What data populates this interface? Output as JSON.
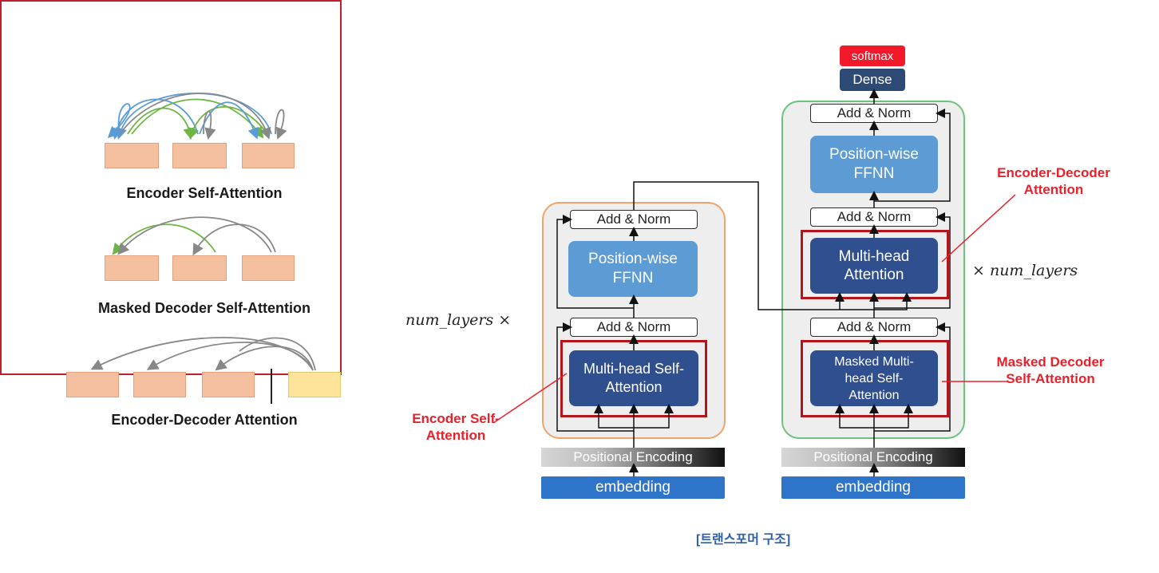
{
  "left_panel": {
    "encoder_self_attention": "Encoder Self-Attention",
    "masked_decoder_self_attention": "Masked Decoder Self-Attention",
    "encoder_decoder_attention": "Encoder-Decoder Attention"
  },
  "encoder": {
    "add_norm_top": "Add & Norm",
    "ffnn": "Position-wise FFNN",
    "add_norm_bottom": "Add & Norm",
    "mha": "Multi-head Self-Attention",
    "positional_encoding": "Positional Encoding",
    "embedding": "embedding",
    "repeat_label": "num_layers ×",
    "annotation": "Encoder Self-Attention"
  },
  "decoder": {
    "softmax": "softmax",
    "dense": "Dense",
    "add_norm_top": "Add & Norm",
    "ffnn": "Position-wise FFNN",
    "add_norm_mid": "Add & Norm",
    "mha": "Multi-head Attention",
    "add_norm_bottom": "Add & Norm",
    "masked_mha": "Masked Multi-head Self-Attention",
    "positional_encoding": "Positional Encoding",
    "embedding": "embedding",
    "repeat_label": "× num_layers",
    "annotation_top": "Encoder-Decoder Attention",
    "annotation_bottom": "Masked Decoder Self-Attention"
  },
  "caption": "[트랜스포머 구조]",
  "colors": {
    "red_frame": "#b3151d",
    "annotation_red": "#e8212b",
    "encoder_border": "#f0a46a",
    "decoder_border": "#6cc47a",
    "ffnn_blue": "#5d9bd5",
    "mha_navy": "#2f4f8f",
    "embedding_blue": "#2e75c9",
    "softmax_red": "#f2192b",
    "dense_navy": "#2c4a74",
    "token_orange": "#f5c09f",
    "token_yellow": "#fde49a",
    "arrow_blue": "#5b9bd5",
    "arrow_green": "#6fb545",
    "arrow_gray": "#888888"
  }
}
